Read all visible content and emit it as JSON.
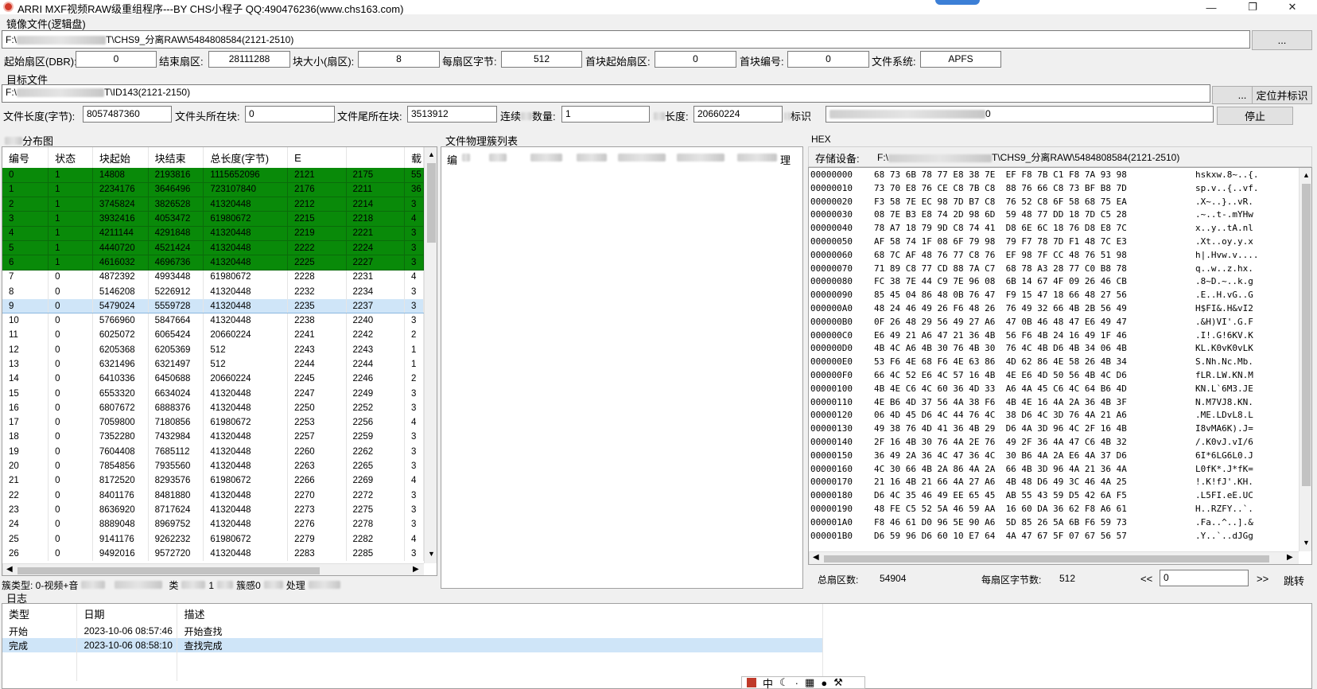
{
  "window": {
    "title": "ARRI MXF视频RAW级重组程序---BY CHS小程子  QQ:490476236(www.chs163.com)"
  },
  "image_file": {
    "section_label": "镜像文件(逻辑盘)",
    "path_prefix": "F:\\",
    "path_suffix": "T\\CHS9_分离RAW\\5484808584(2121-2510)",
    "browse_label": "...",
    "fields": {
      "start_sector_label": "起始扇区(DBR):",
      "start_sector": "0",
      "end_sector_label": "结束扇区:",
      "end_sector": "28111288",
      "block_size_label": "块大小(扇区):",
      "block_size": "8",
      "bytes_per_sector_label": "每扇区字节:",
      "bytes_per_sector": "512",
      "first_block_sector_label": "首块起始扇区:",
      "first_block_sector": "0",
      "first_block_no_label": "首块编号:",
      "first_block_no": "0",
      "fs_label": "文件系统:",
      "fs": "APFS"
    }
  },
  "target_file": {
    "section_label": "目标文件",
    "path_prefix": "F:\\",
    "path_suffix": "T\\ID143(2121-2150)",
    "browse_label": "...",
    "locate_label": "定位并标识",
    "stop_label": "停止",
    "file_length_label": "文件长度(字节):",
    "file_length": "8057487360",
    "head_block_label": "文件头所在块:",
    "head_block": "0",
    "tail_block_label": "文件尾所在块:",
    "tail_block": "3513912",
    "cont_count_label": "连续",
    "cont_count_label2": "数量:",
    "cont_count": "1",
    "length_label": "长度:",
    "length": "20660224",
    "mark_label": "标识",
    "mark_value": "0"
  },
  "left_panel": {
    "section_label": "分布图",
    "columns": [
      "编号",
      "状态",
      "块起始",
      "块结束",
      "总长度(字节)",
      "E",
      "",
      "载"
    ],
    "rows": [
      [
        "0",
        "1",
        "14808",
        "2193816",
        "1115652096",
        "2121",
        "2175",
        "55"
      ],
      [
        "1",
        "1",
        "2234176",
        "3646496",
        "723107840",
        "2176",
        "2211",
        "36"
      ],
      [
        "2",
        "1",
        "3745824",
        "3826528",
        "41320448",
        "2212",
        "2214",
        "3"
      ],
      [
        "3",
        "1",
        "3932416",
        "4053472",
        "61980672",
        "2215",
        "2218",
        "4"
      ],
      [
        "4",
        "1",
        "4211144",
        "4291848",
        "41320448",
        "2219",
        "2221",
        "3"
      ],
      [
        "5",
        "1",
        "4440720",
        "4521424",
        "41320448",
        "2222",
        "2224",
        "3"
      ],
      [
        "6",
        "1",
        "4616032",
        "4696736",
        "41320448",
        "2225",
        "2227",
        "3"
      ],
      [
        "7",
        "0",
        "4872392",
        "4993448",
        "61980672",
        "2228",
        "2231",
        "4"
      ],
      [
        "8",
        "0",
        "5146208",
        "5226912",
        "41320448",
        "2232",
        "2234",
        "3"
      ],
      [
        "9",
        "0",
        "5479024",
        "5559728",
        "41320448",
        "2235",
        "2237",
        "3"
      ],
      [
        "10",
        "0",
        "5766960",
        "5847664",
        "41320448",
        "2238",
        "2240",
        "3"
      ],
      [
        "11",
        "0",
        "6025072",
        "6065424",
        "20660224",
        "2241",
        "2242",
        "2"
      ],
      [
        "12",
        "0",
        "6205368",
        "6205369",
        "512",
        "2243",
        "2243",
        "1"
      ],
      [
        "13",
        "0",
        "6321496",
        "6321497",
        "512",
        "2244",
        "2244",
        "1"
      ],
      [
        "14",
        "0",
        "6410336",
        "6450688",
        "20660224",
        "2245",
        "2246",
        "2"
      ],
      [
        "15",
        "0",
        "6553320",
        "6634024",
        "41320448",
        "2247",
        "2249",
        "3"
      ],
      [
        "16",
        "0",
        "6807672",
        "6888376",
        "41320448",
        "2250",
        "2252",
        "3"
      ],
      [
        "17",
        "0",
        "7059800",
        "7180856",
        "61980672",
        "2253",
        "2256",
        "4"
      ],
      [
        "18",
        "0",
        "7352280",
        "7432984",
        "41320448",
        "2257",
        "2259",
        "3"
      ],
      [
        "19",
        "0",
        "7604408",
        "7685112",
        "41320448",
        "2260",
        "2262",
        "3"
      ],
      [
        "20",
        "0",
        "7854856",
        "7935560",
        "41320448",
        "2263",
        "2265",
        "3"
      ],
      [
        "21",
        "0",
        "8172520",
        "8293576",
        "61980672",
        "2266",
        "2269",
        "4"
      ],
      [
        "22",
        "0",
        "8401176",
        "8481880",
        "41320448",
        "2270",
        "2272",
        "3"
      ],
      [
        "23",
        "0",
        "8636920",
        "8717624",
        "41320448",
        "2273",
        "2275",
        "3"
      ],
      [
        "24",
        "0",
        "8889048",
        "8969752",
        "41320448",
        "2276",
        "2278",
        "3"
      ],
      [
        "25",
        "0",
        "9141176",
        "9262232",
        "61980672",
        "2279",
        "2282",
        "4"
      ],
      [
        "26",
        "0",
        "9492016",
        "9572720",
        "41320448",
        "2283",
        "2285",
        "3"
      ]
    ],
    "green_rows": 7,
    "selected_row": 9,
    "footer_label": "簇类型: 0-视频+音",
    "footer_mid": "类",
    "footer_mid2": "1",
    "footer_mid3": "簇感0",
    "footer_mid4": "处理"
  },
  "middle_panel": {
    "section_label": "文件物理簇列表",
    "header_first": "编",
    "header_last": "理"
  },
  "hex_panel": {
    "section_label": "HEX",
    "device_label": "存储设备:",
    "device_path_prefix": "F:\\",
    "device_path_suffix": "T\\CHS9_分离RAW\\5484808584(2121-2510)",
    "rows": [
      [
        "00000000",
        "68 73 6B 78 77 E8 38 7E  EF F8 7B C1 F8 7A 93 98",
        "hskxw.8~..{."
      ],
      [
        "00000010",
        "73 70 E8 76 CE C8 7B C8  88 76 66 C8 73 BF B8 7D",
        "sp.v..{..vf."
      ],
      [
        "00000020",
        "F3 58 7E EC 98 7D B7 C8  76 52 C8 6F 58 68 75 EA",
        ".X~..}..vR."
      ],
      [
        "00000030",
        "08 7E B3 E8 74 2D 98 6D  59 48 77 DD 18 7D C5 28",
        ".~..t-.mYHw"
      ],
      [
        "00000040",
        "78 A7 18 79 9D C8 74 41  D8 6E 6C 18 76 D8 E8 7C",
        "x..y..tA.nl"
      ],
      [
        "00000050",
        "AF 58 74 1F 08 6F 79 98  79 F7 78 7D F1 48 7C E3",
        ".Xt..oy.y.x"
      ],
      [
        "00000060",
        "68 7C AF 48 76 77 C8 76  EF 98 7F CC 48 76 51 98",
        "h|.Hvw.v...."
      ],
      [
        "00000070",
        "71 89 C8 77 CD 88 7A C7  68 78 A3 28 77 C0 B8 78",
        "q..w..z.hx."
      ],
      [
        "00000080",
        "FC 38 7E 44 C9 7E 96 08  6B 14 67 4F 09 26 46 CB",
        ".8~D.~..k.g"
      ],
      [
        "00000090",
        "85 45 04 86 48 0B 76 47  F9 15 47 18 66 48 27 56",
        ".E..H.vG..G"
      ],
      [
        "000000A0",
        "48 24 46 49 26 F6 48 26  76 49 32 66 4B 2B 56 49",
        "H$FI&.H&vI2"
      ],
      [
        "000000B0",
        "0F 26 48 29 56 49 27 A6  47 0B 46 48 47 E6 49 47",
        ".&H)VI'.G.F"
      ],
      [
        "000000C0",
        "E6 49 21 A6 47 21 36 4B  56 F6 4B 24 16 49 1F 46",
        ".I!.G!6KV.K"
      ],
      [
        "000000D0",
        "4B 4C A6 4B 30 76 4B 30  76 4C 4B D6 4B 34 06 4B",
        "KL.K0vK0vLK"
      ],
      [
        "000000E0",
        "53 F6 4E 68 F6 4E 63 86  4D 62 86 4E 58 26 4B 34",
        "S.Nh.Nc.Mb."
      ],
      [
        "000000F0",
        "66 4C 52 E6 4C 57 16 4B  4E E6 4D 50 56 4B 4C D6",
        "fLR.LW.KN.M"
      ],
      [
        "00000100",
        "4B 4E C6 4C 60 36 4D 33  A6 4A 45 C6 4C 64 B6 4D",
        "KN.L`6M3.JE"
      ],
      [
        "00000110",
        "4E B6 4D 37 56 4A 38 F6  4B 4E 16 4A 2A 36 4B 3F",
        "N.M7VJ8.KN."
      ],
      [
        "00000120",
        "06 4D 45 D6 4C 44 76 4C  38 D6 4C 3D 76 4A 21 A6",
        ".ME.LDvL8.L"
      ],
      [
        "00000130",
        "49 38 76 4D 41 36 4B 29  D6 4A 3D 96 4C 2F 16 4B",
        "I8vMA6K).J="
      ],
      [
        "00000140",
        "2F 16 4B 30 76 4A 2E 76  49 2F 36 4A 47 C6 4B 32",
        "/.K0vJ.vI/6"
      ],
      [
        "00000150",
        "36 49 2A 36 4C 47 36 4C  30 B6 4A 2A E6 4A 37 D6",
        "6I*6LG6L0.J"
      ],
      [
        "00000160",
        "4C 30 66 4B 2A 86 4A 2A  66 4B 3D 96 4A 21 36 4A",
        "L0fK*.J*fK="
      ],
      [
        "00000170",
        "21 16 4B 21 66 4A 27 A6  4B 48 D6 49 3C 46 4A 25",
        "!.K!fJ'.KH."
      ],
      [
        "00000180",
        "D6 4C 35 46 49 EE 65 45  AB 55 43 59 D5 42 6A F5",
        ".L5FI.eE.UC"
      ],
      [
        "00000190",
        "48 FE C5 52 5A 46 59 AA  16 60 DA 36 62 F8 A6 61",
        "H..RZFY..`."
      ],
      [
        "000001A0",
        "F8 46 61 D0 96 5E 90 A6  5D 85 26 5A 6B F6 59 73",
        ".Fa..^..].&"
      ],
      [
        "000001B0",
        "D6 59 96 D6 60 10 E7 64  4A 47 67 5F 07 67 56 57",
        ".Y..`..dJGg"
      ]
    ],
    "total_sectors_label": "总扇区数:",
    "total_sectors": "54904",
    "bytes_per_sector_label": "每扇区字节数:",
    "bytes_per_sector": "512",
    "prev_label": "<<",
    "page_value": "0",
    "next_label": ">>",
    "jump_label": "跳转"
  },
  "log": {
    "section_label": "日志",
    "columns": [
      "类型",
      "日期",
      "描述"
    ],
    "rows": [
      [
        "开始",
        "2023-10-06 08:57:46",
        "开始查找"
      ],
      [
        "完成",
        "2023-10-06 08:58:10",
        "查找完成"
      ]
    ],
    "selected_row": 1
  },
  "ime_bar": {
    "items": [
      "中",
      "·"
    ]
  },
  "colors": {
    "green_row": "#098a09",
    "selection": "#cfe5f8"
  }
}
